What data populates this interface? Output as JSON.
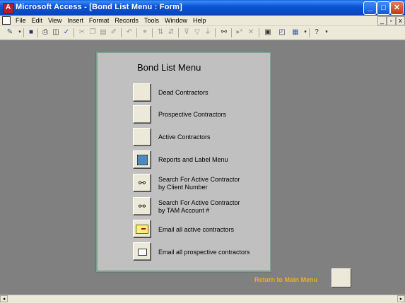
{
  "window": {
    "title": "Microsoft Access - [Bond List Menu : Form]"
  },
  "caption_buttons": {
    "minimize": "_",
    "maximize": "□",
    "close": "✕"
  },
  "menubar": {
    "items": [
      "File",
      "Edit",
      "View",
      "Insert",
      "Format",
      "Records",
      "Tools",
      "Window",
      "Help"
    ],
    "mdi": {
      "minimize": "_",
      "restore": "▫",
      "close": "x"
    }
  },
  "form": {
    "heading": "Bond List Menu",
    "items": [
      {
        "label": "Dead Contractors"
      },
      {
        "label": "Prospective Contractors"
      },
      {
        "label": "Active Contractors"
      },
      {
        "label": "Reports and Label Menu"
      },
      {
        "label": "Search For Active Contractor",
        "label2": "by Client Number"
      },
      {
        "label": "Search For Active Contractor",
        "label2": "by TAM Account #"
      },
      {
        "label": "Email all active contractors"
      },
      {
        "label": "Email all prospective contractors"
      }
    ],
    "return_label": "Return to Main Menu"
  },
  "colors": {
    "titlebar": "#0a55d4",
    "workspace": "#808080",
    "form_bg": "#c0c0c0",
    "return_text": "#e8b020"
  }
}
